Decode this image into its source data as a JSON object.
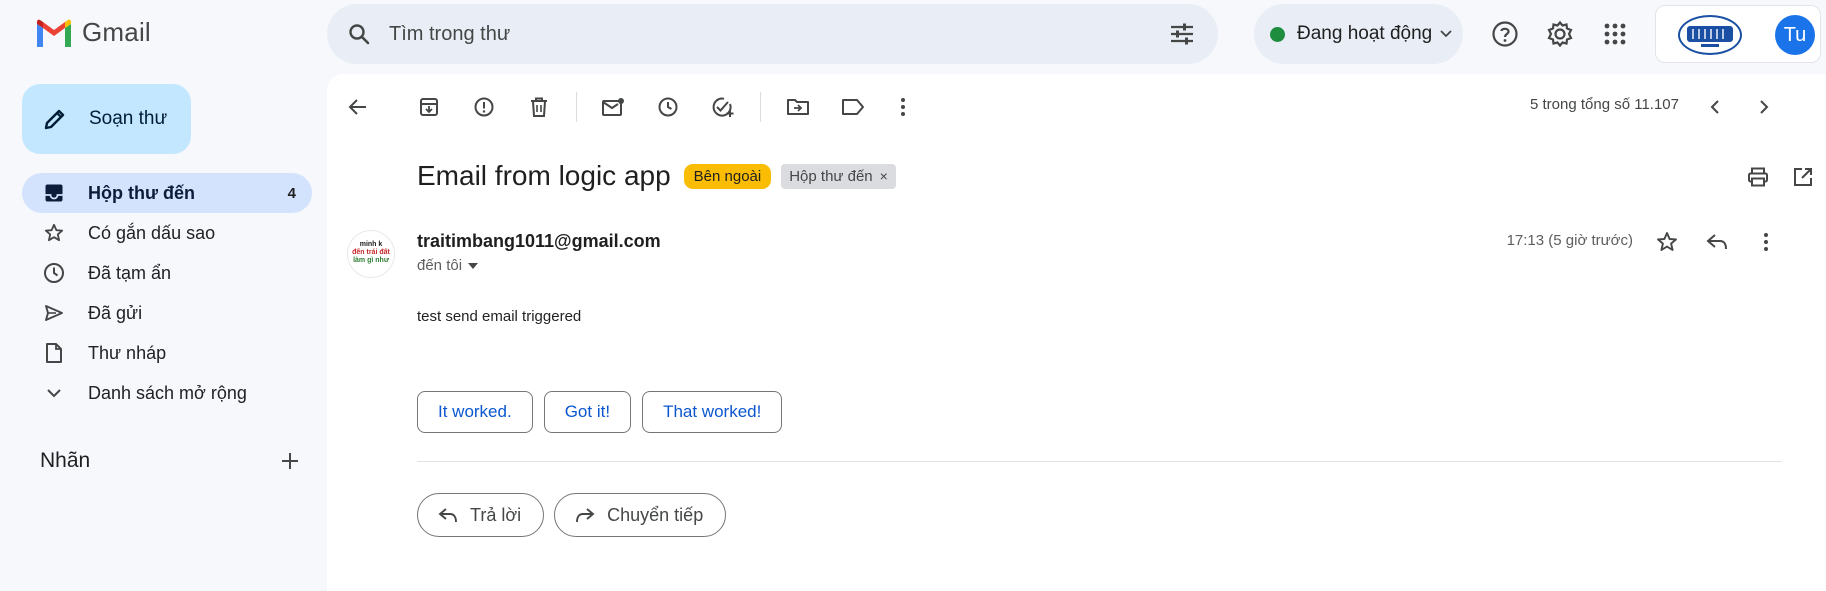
{
  "app": {
    "name": "Gmail"
  },
  "search": {
    "placeholder": "Tìm trong thư"
  },
  "status": {
    "label": "Đang hoạt động",
    "color": "#1e8e3e"
  },
  "account": {
    "avatar_initials": "Tu",
    "avatar_color": "#1a73e8"
  },
  "compose": {
    "label": "Soạn thư"
  },
  "sidebar": {
    "items": [
      {
        "label": "Hộp thư đến",
        "count": "4",
        "icon": "inbox-icon",
        "active": true
      },
      {
        "label": "Có gắn dấu sao",
        "icon": "star-icon"
      },
      {
        "label": "Đã tạm ẩn",
        "icon": "clock-icon"
      },
      {
        "label": "Đã gửi",
        "icon": "send-icon"
      },
      {
        "label": "Thư nháp",
        "icon": "draft-icon"
      },
      {
        "label": "Danh sách mở rộng",
        "icon": "chevron-down-icon"
      }
    ],
    "labels_title": "Nhãn"
  },
  "toolbar": {
    "paging": "5 trong tổng số 11.107"
  },
  "email": {
    "subject": "Email from logic app",
    "badge_external": "Bên ngoài",
    "badge_inbox": "Hộp thư đến",
    "sender": "traitimbang1011@gmail.com",
    "avatar_text": [
      "minh k",
      "đến trái đất",
      "làm gì như"
    ],
    "recipient": "đến tôi",
    "time": "17:13 (5 giờ trước)",
    "body": "test send email triggered",
    "smart_replies": [
      "It worked.",
      "Got it!",
      "That worked!"
    ],
    "reply_label": "Trả lời",
    "forward_label": "Chuyển tiếp"
  }
}
